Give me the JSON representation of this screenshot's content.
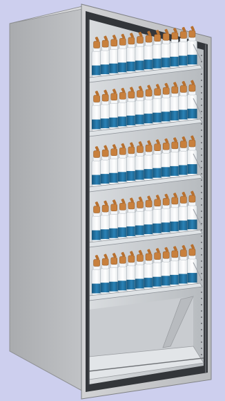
{
  "scene": {
    "subject": "cabinet",
    "shelf_count": 5,
    "bottles_per_shelf": 12,
    "colors": {
      "background": "#cdcfee",
      "cabinet_frame": "#c6c7c9",
      "cabinet_side": "#b2b4b7",
      "door_frame": "#3a3c40",
      "shelf": "#dfe3e6",
      "bottle_body": "#ffffff",
      "bottle_label": "#1f6e9d",
      "bottle_cap": "#c8803d",
      "lower_panel": "#cfd2d6"
    }
  }
}
